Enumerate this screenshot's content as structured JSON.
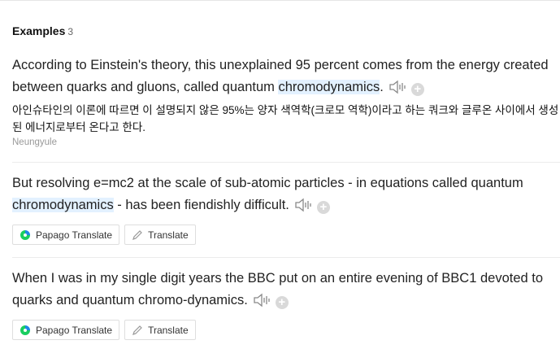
{
  "section": {
    "title": "Examples",
    "count": "3"
  },
  "examples": [
    {
      "pre": "According to Einstein's theory, this unexplained 95 percent comes from the energy created between quarks and gluons, called quantum ",
      "highlight": "chromodynamics",
      "post": ".",
      "translation": "아인슈타인의 이론에 따르면 이 설명되지 않은 95%는 양자 색역학(크로모 역학)이라고 하는 쿼크와 글루온 사이에서 생성된 에너지로부터 온다고 한다.",
      "source": "Neungyule"
    },
    {
      "pre": "But resolving e=mc2 at the scale of sub-atomic particles - in equations called quantum ",
      "highlight": "chromodynamics",
      "post": " - has been fiendishly difficult."
    },
    {
      "pre": "When I was in my single digit years the BBC put on an entire evening of BBC1 devoted to quarks and quantum chromo-dynamics.",
      "highlight": "",
      "post": ""
    }
  ],
  "buttons": {
    "papago": "Papago Translate",
    "translate": "Translate"
  },
  "plus_symbol": "+",
  "colors": {
    "highlight": "#e3f1ff",
    "papago_green": "#19ce60",
    "papago_blue": "#1e88e5"
  }
}
